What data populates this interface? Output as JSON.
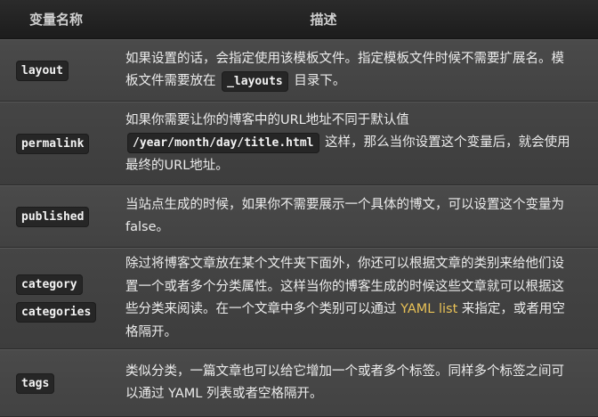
{
  "header": {
    "col1": "变量名称",
    "col2": "描述"
  },
  "rows": [
    {
      "names": [
        "layout"
      ],
      "desc": {
        "t1": "如果设置的话，会指定使用该模板文件。指定模板文件时候不需要扩展名。模板文件需要放在 ",
        "code": "_layouts",
        "t2": " 目录下。"
      }
    },
    {
      "names": [
        "permalink"
      ],
      "desc": {
        "t1": "如果你需要让你的博客中的URL地址不同于默认值 ",
        "code": "/year/month/day/title.html",
        "t2": " 这样，那么当你设置这个变量后，就会使用最终的URL地址。"
      }
    },
    {
      "names": [
        "published"
      ],
      "desc": {
        "t1": "当站点生成的时候，如果你不需要展示一个具体的博文，可以设置这个变量为 false。"
      }
    },
    {
      "names": [
        "category",
        "categories"
      ],
      "desc": {
        "t1": "除过将博客文章放在某个文件夹下面外，你还可以根据文章的类别来给他们设置一个或者多个分类属性。这样当你的博客生成的时候这些文章就可以根据这些分类来阅读。在一个文章中多个类别可以通过 ",
        "link": "YAML list",
        "t2": " 来指定，或者用空格隔开。"
      }
    },
    {
      "names": [
        "tags"
      ],
      "desc": {
        "t1": "类似分类，一篇文章也可以给它增加一个或者多个标签。同样多个标签之间可以通过 YAML 列表或者空格隔开。"
      }
    }
  ]
}
